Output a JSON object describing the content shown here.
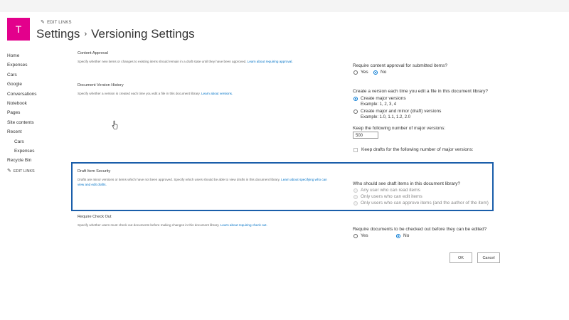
{
  "site": {
    "logo_letter": "T",
    "edit_links_label": "EDIT LINKS",
    "brand_color": "#e3008c"
  },
  "title": {
    "part1": "Settings",
    "separator": "›",
    "part2": "Versioning Settings"
  },
  "nav": {
    "items": [
      {
        "label": "Home",
        "sub": false
      },
      {
        "label": "Expenses",
        "sub": false
      },
      {
        "label": "Cars",
        "sub": false
      },
      {
        "label": "Google",
        "sub": false
      },
      {
        "label": "Conversations",
        "sub": false
      },
      {
        "label": "Notebook",
        "sub": false
      },
      {
        "label": "Pages",
        "sub": false
      },
      {
        "label": "Site contents",
        "sub": false
      },
      {
        "label": "Recent",
        "sub": false
      },
      {
        "label": "Cars",
        "sub": true
      },
      {
        "label": "Expenses",
        "sub": true
      },
      {
        "label": "Recycle Bin",
        "sub": false
      }
    ],
    "edit_links_label": "EDIT LINKS"
  },
  "sections": {
    "content_approval": {
      "title": "Content Approval",
      "desc": "Specify whether new items or changes to existing items should remain in a draft state until they have been approved.",
      "link": "Learn about requiring approval.",
      "question": "Require content approval for submitted items?",
      "yes": "Yes",
      "no": "No"
    },
    "version_history": {
      "title": "Document Version History",
      "desc": "Specify whether a version is created each time you edit a file in this document library.",
      "link": "Learn about versions.",
      "question": "Create a version each time you edit a file in this document library?",
      "opt_major": "Create major versions",
      "example_major": "Example: 1, 2, 3, 4",
      "opt_minor": "Create major and minor (draft) versions",
      "example_minor": "Example: 1.0, 1.1, 1.2, 2.0",
      "keep_label": "Keep the following number of major versions:",
      "keep_value": "500",
      "keep_drafts_label": "Keep drafts for the following number of major versions:"
    },
    "draft_security": {
      "title": "Draft Item Security",
      "desc": "Drafts are minor versions or items which have not been approved. Specify which users should be able to view drafts in this document library.",
      "link": "Learn about specifying who can view and edit drafts.",
      "question": "Who should see draft items in this document library?",
      "opt_read": "Any user who can read items",
      "opt_edit": "Only users who can edit items",
      "opt_approve": "Only users who can approve items (and the author of the item)",
      "highlight_color": "#1a5eaa"
    },
    "check_out": {
      "title": "Require Check Out",
      "desc": "Specify whether users must check out documents before making changes in this document library.",
      "link": "Learn about requiring check out.",
      "question": "Require documents to be checked out before they can be edited?",
      "yes": "Yes",
      "no": "No"
    }
  },
  "buttons": {
    "ok": "OK",
    "cancel": "Cancel"
  },
  "icons": {
    "edit": "pencil-icon",
    "cursor": "hand-cursor-icon"
  }
}
